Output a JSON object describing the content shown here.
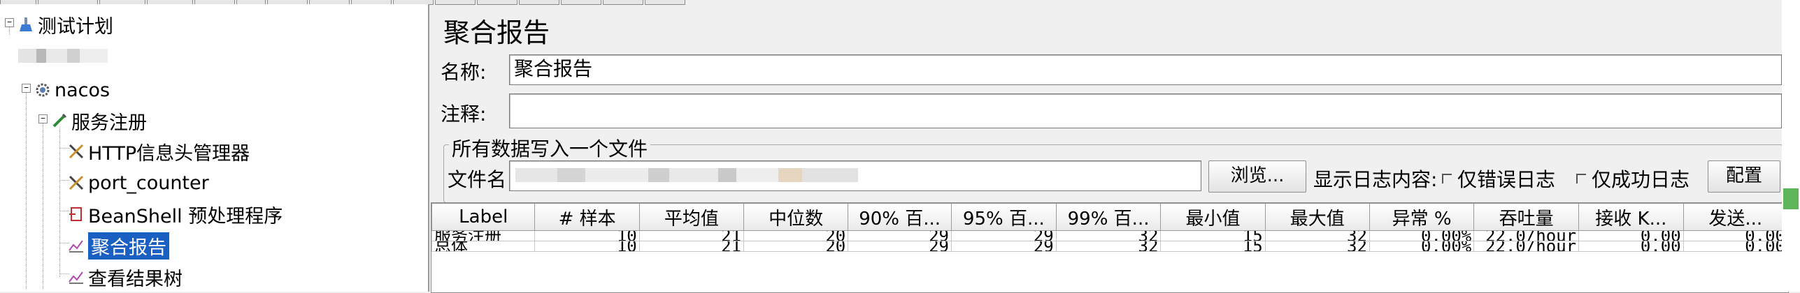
{
  "tree": {
    "root_label": "测试计划",
    "items": [
      {
        "label": "nacos"
      },
      {
        "label": "服务注册"
      },
      {
        "label": "HTTP信息头管理器"
      },
      {
        "label": "port_counter"
      },
      {
        "label": "BeanShell 预处理程序"
      },
      {
        "label": "聚合报告",
        "selected": true
      },
      {
        "label": "查看结果树"
      }
    ]
  },
  "panel": {
    "title": "聚合报告",
    "name_label": "名称:",
    "name_value": "聚合报告",
    "comment_label": "注释:",
    "comment_value": "",
    "group_title": "所有数据写入一个文件",
    "file_label": "文件名",
    "browse_button": "浏览...",
    "log_display_label": "显示日志内容:",
    "errors_only_label": "仅错误日志",
    "success_only_label": "仅成功日志",
    "configure_button": "配置"
  },
  "table": {
    "columns": [
      "Label",
      "# 样本",
      "平均值",
      "中位数",
      "90% 百...",
      "95% 百...",
      "99% 百...",
      "最小值",
      "最大值",
      "异常 %",
      "吞吐量",
      "接收 K...",
      "发送..."
    ],
    "rows": [
      [
        "服务注册",
        "10",
        "21",
        "20",
        "29",
        "29",
        "32",
        "15",
        "32",
        "0.00%",
        "22.0/hour",
        "0.00",
        "0.00"
      ],
      [
        "总体",
        "10",
        "21",
        "20",
        "29",
        "29",
        "32",
        "15",
        "32",
        "0.00%",
        "22.0/hour",
        "0.00",
        "0.00"
      ]
    ]
  }
}
